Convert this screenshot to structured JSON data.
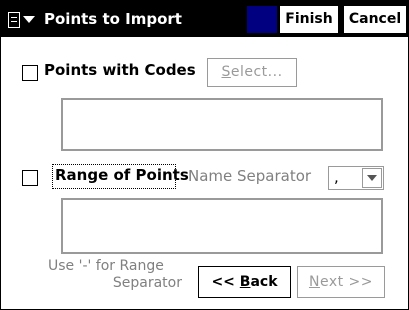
{
  "window": {
    "title": "Points to Import",
    "finish_label": "Finish",
    "cancel_label": "Cancel"
  },
  "points_with_codes": {
    "checkbox_label": "Points with Codes",
    "checked": false,
    "select_button": {
      "mnemonic": "S",
      "rest": "elect..."
    },
    "codes_value": ""
  },
  "range_of_points": {
    "checkbox_label": "Range of Points",
    "checked": false,
    "separator_label": "Name Separator",
    "separator_value": ",",
    "range_value": "",
    "hint_line1": "Use '-' for Range",
    "hint_line2": "Separator"
  },
  "navigation": {
    "back": {
      "prefix": "<< ",
      "mnemonic": "B",
      "rest": "ack"
    },
    "next": {
      "mnemonic": "N",
      "rest": "ext >>"
    }
  },
  "colors": {
    "titlebar": "#000000",
    "title_accent": "#000080",
    "disabled": "#9a9a9a"
  },
  "icons": [
    "window-menu-icon",
    "dropdown-arrow-icon"
  ]
}
